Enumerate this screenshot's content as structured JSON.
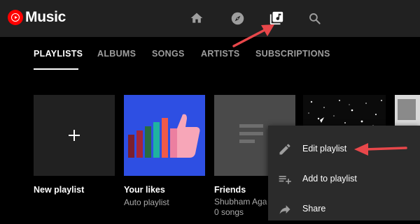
{
  "app": {
    "title": "Music"
  },
  "colors": {
    "brand": "#ff0000",
    "arrow": "#e8474a",
    "topbar": "#212121",
    "menu": "#2b2b2b"
  },
  "nav": {
    "icons": [
      "home-icon",
      "explore-compass-icon",
      "library-icon",
      "search-icon"
    ]
  },
  "tabs": [
    {
      "label": "PLAYLISTS",
      "active": true
    },
    {
      "label": "ALBUMS",
      "active": false
    },
    {
      "label": "SONGS",
      "active": false
    },
    {
      "label": "ARTISTS",
      "active": false
    },
    {
      "label": "SUBSCRIPTIONS",
      "active": false
    }
  ],
  "playlists": [
    {
      "title": "New playlist"
    },
    {
      "title": "Your likes",
      "subtitle": "Auto playlist"
    },
    {
      "title": "Friends",
      "subtitle": "Shubham Aga",
      "count": "0 songs"
    }
  ],
  "context_menu": {
    "items": [
      {
        "label": "Edit playlist",
        "icon": "pencil-icon"
      },
      {
        "label": "Add to playlist",
        "icon": "playlist-add-icon"
      },
      {
        "label": "Share",
        "icon": "share-icon"
      }
    ]
  }
}
